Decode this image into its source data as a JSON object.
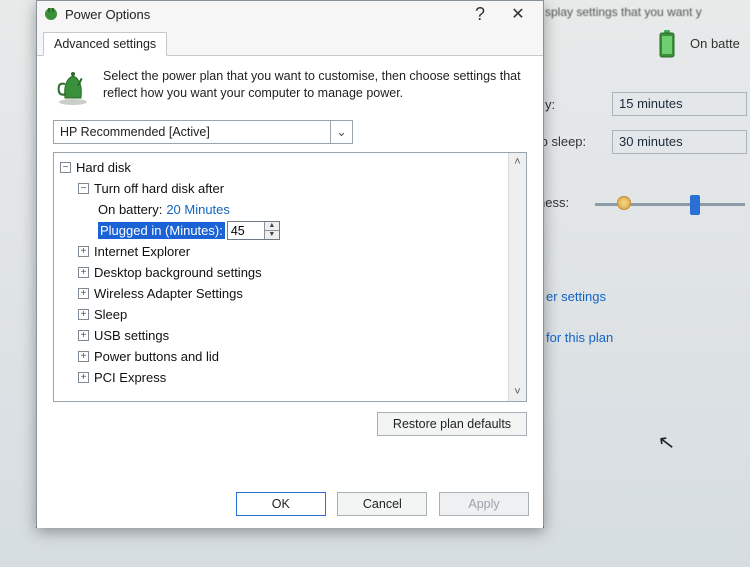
{
  "background": {
    "top_text": "splay settings that you want y",
    "on_battery": "On batte",
    "row1_label": "y:",
    "row1_value": "15 minutes",
    "row2_label": "to sleep:",
    "row2_value": "30 minutes",
    "brightness_label": "ness:",
    "link1": "er settings",
    "link2": "for this plan"
  },
  "dialog": {
    "title": "Power Options",
    "tab_label": "Advanced settings",
    "intro": "Select the power plan that you want to customise, then choose settings that reflect how you want your computer to manage power.",
    "plan_selected": "HP Recommended [Active]",
    "restore_btn": "Restore plan defaults",
    "ok": "OK",
    "cancel": "Cancel",
    "apply": "Apply"
  },
  "tree": {
    "hard_disk": "Hard disk",
    "turn_off": "Turn off hard disk after",
    "on_battery_label": "On battery:",
    "on_battery_value": "20 Minutes",
    "plugged_label": "Plugged in (Minutes):",
    "plugged_value": "45",
    "ie": "Internet Explorer",
    "desktop_bg": "Desktop background settings",
    "wireless": "Wireless Adapter Settings",
    "sleep": "Sleep",
    "usb": "USB settings",
    "power_buttons": "Power buttons and lid",
    "pci": "PCI Express"
  }
}
